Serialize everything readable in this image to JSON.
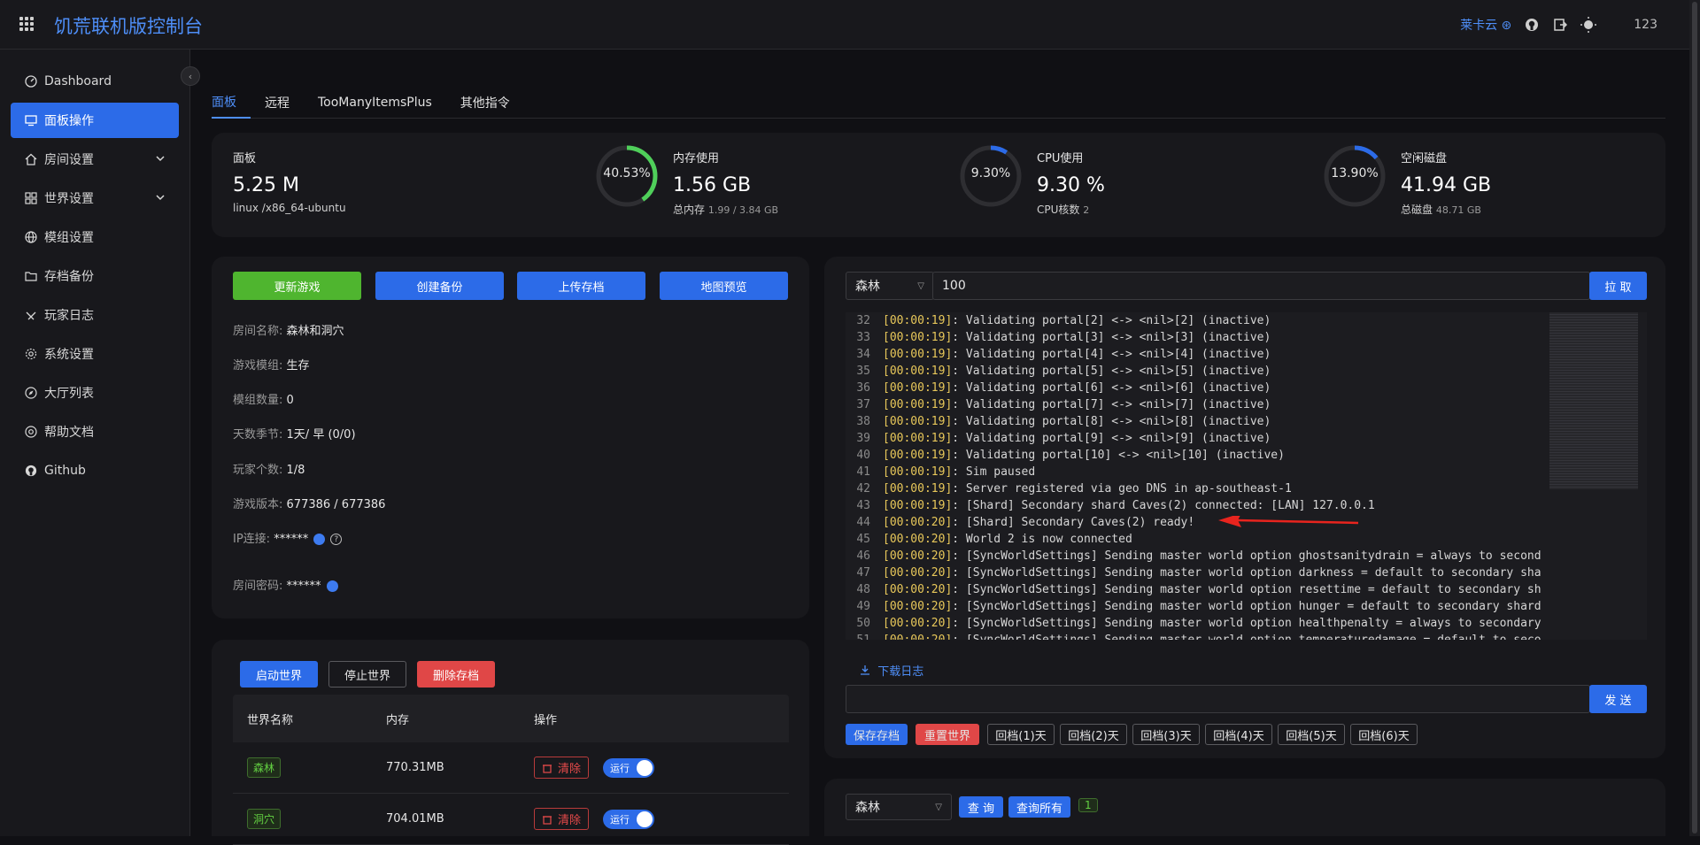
{
  "app": {
    "title": "饥荒联机版控制台",
    "user": "123",
    "top_link": "莱卡云"
  },
  "sidebar": {
    "items": [
      {
        "label": "Dashboard"
      },
      {
        "label": "面板操作"
      },
      {
        "label": "房间设置"
      },
      {
        "label": "世界设置"
      },
      {
        "label": "模组设置"
      },
      {
        "label": "存档备份"
      },
      {
        "label": "玩家日志"
      },
      {
        "label": "系统设置"
      },
      {
        "label": "大厅列表"
      },
      {
        "label": "帮助文档"
      },
      {
        "label": "Github"
      }
    ]
  },
  "tabs": [
    "面板",
    "远程",
    "TooManyItemsPlus",
    "其他指令"
  ],
  "stats": {
    "panel": {
      "label": "面板",
      "value": "5.25 M",
      "sub": "linux /x86_64-ubuntu"
    },
    "memory": {
      "label": "内存使用",
      "value": "1.56 GB",
      "percent": 40.53,
      "percent_text": "40.53%",
      "sub_label": "总内存",
      "sub_value": "1.99 / 3.84 GB"
    },
    "cpu": {
      "label": "CPU使用",
      "value": "9.30 %",
      "percent": 9.3,
      "percent_text": "9.30%",
      "sub_label": "CPU核数",
      "sub_value": "2"
    },
    "disk": {
      "label": "空闲磁盘",
      "value": "41.94 GB",
      "percent": 13.9,
      "percent_text": "13.90%",
      "sub_label": "总磁盘",
      "sub_value": "48.71 GB"
    }
  },
  "actions": {
    "update": "更新游戏",
    "backup": "创建备份",
    "upload": "上传存档",
    "map": "地图预览"
  },
  "room_info": [
    {
      "label": "房间名称:",
      "value": "森林和洞穴"
    },
    {
      "label": "游戏模组:",
      "value": "生存"
    },
    {
      "label": "模组数量:",
      "value": "0"
    },
    {
      "label": "天数季节:",
      "value": "1天/ 早 (0/0)"
    },
    {
      "label": "玩家个数:",
      "value": "1/8"
    },
    {
      "label": "游戏版本:",
      "value": "677386 / 677386"
    },
    {
      "label": "IP连接:",
      "value": "******"
    },
    {
      "label": "房间密码:",
      "value": "******"
    }
  ],
  "world_controls": {
    "start": "启动世界",
    "stop": "停止世界",
    "delete": "删除存档"
  },
  "world_table": {
    "headers": [
      "世界名称",
      "内存",
      "操作"
    ],
    "rows": [
      {
        "name": "森林",
        "memory": "770.31MB",
        "clear": "清除",
        "status": "运行"
      },
      {
        "name": "洞穴",
        "memory": "704.01MB",
        "clear": "清除",
        "status": "运行"
      }
    ]
  },
  "log_panel": {
    "world_select": "森林",
    "lines_input": "100",
    "fetch_btn": "拉 取",
    "download": "下载日志",
    "send_btn": "发 送",
    "lines": [
      {
        "n": "32",
        "ts": "[00:00:19]",
        "text": ": Validating portal[2] <-> <nil>[2] (inactive)"
      },
      {
        "n": "33",
        "ts": "[00:00:19]",
        "text": ": Validating portal[3] <-> <nil>[3] (inactive)"
      },
      {
        "n": "34",
        "ts": "[00:00:19]",
        "text": ": Validating portal[4] <-> <nil>[4] (inactive)"
      },
      {
        "n": "35",
        "ts": "[00:00:19]",
        "text": ": Validating portal[5] <-> <nil>[5] (inactive)"
      },
      {
        "n": "36",
        "ts": "[00:00:19]",
        "text": ": Validating portal[6] <-> <nil>[6] (inactive)"
      },
      {
        "n": "37",
        "ts": "[00:00:19]",
        "text": ": Validating portal[7] <-> <nil>[7] (inactive)"
      },
      {
        "n": "38",
        "ts": "[00:00:19]",
        "text": ": Validating portal[8] <-> <nil>[8] (inactive)"
      },
      {
        "n": "39",
        "ts": "[00:00:19]",
        "text": ": Validating portal[9] <-> <nil>[9] (inactive)"
      },
      {
        "n": "40",
        "ts": "[00:00:19]",
        "text": ": Validating portal[10] <-> <nil>[10] (inactive)"
      },
      {
        "n": "41",
        "ts": "[00:00:19]",
        "text": ": Sim paused"
      },
      {
        "n": "42",
        "ts": "[00:00:19]",
        "text": ": Server registered via geo DNS in ap-southeast-1"
      },
      {
        "n": "43",
        "ts": "[00:00:19]",
        "text": ": [Shard] Secondary shard Caves(2) connected: [LAN] 127.0.0.1"
      },
      {
        "n": "44",
        "ts": "[00:00:20]",
        "text": ": [Shard] Secondary Caves(2) ready!"
      },
      {
        "n": "45",
        "ts": "[00:00:20]",
        "text": ": World 2 is now connected"
      },
      {
        "n": "46",
        "ts": "[00:00:20]",
        "text": ": [SyncWorldSettings] Sending master world option ghostsanitydrain = always to second"
      },
      {
        "n": "47",
        "ts": "[00:00:20]",
        "text": ": [SyncWorldSettings] Sending master world option darkness = default to secondary sha"
      },
      {
        "n": "48",
        "ts": "[00:00:20]",
        "text": ": [SyncWorldSettings] Sending master world option resettime = default to secondary sh"
      },
      {
        "n": "49",
        "ts": "[00:00:20]",
        "text": ": [SyncWorldSettings] Sending master world option hunger = default to secondary shard"
      },
      {
        "n": "50",
        "ts": "[00:00:20]",
        "text": ": [SyncWorldSettings] Sending master world option healthpenalty = always to secondary"
      },
      {
        "n": "51",
        "ts": "[00:00:20]",
        "text": ": [SyncWorldSettings] Sending master world option temperaturedamage = default to seco"
      }
    ],
    "quick_buttons": [
      "保存存档",
      "重置世界",
      "回档(1)天",
      "回档(2)天",
      "回档(3)天",
      "回档(4)天",
      "回档(5)天",
      "回档(6)天"
    ]
  },
  "query_panel": {
    "world_select": "森林",
    "query_btn": "查 询",
    "query_all_btn": "查询所有",
    "count": "1"
  },
  "colors": {
    "accent": "#2c6be8",
    "green": "#4fb52f",
    "red": "#e04747",
    "bg": "#101014",
    "card": "#18181c"
  }
}
